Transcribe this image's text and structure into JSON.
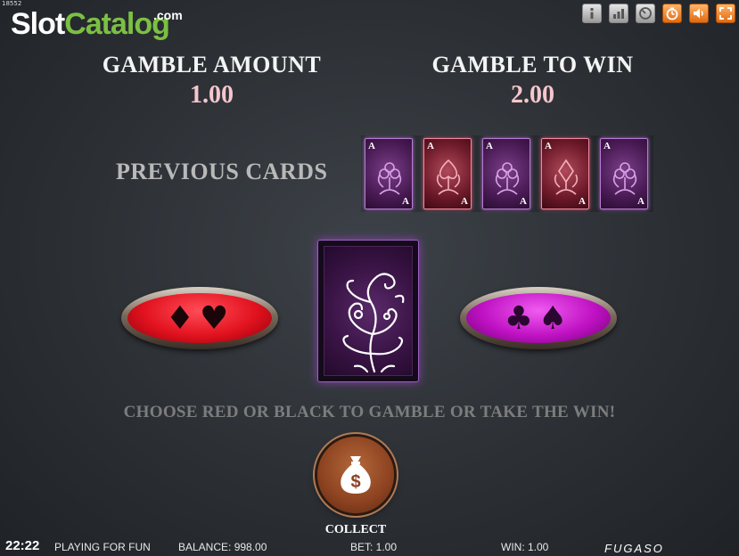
{
  "watermark": {
    "build_id": "18552",
    "logo_slot": "Slot",
    "logo_catalog": "Catalog",
    "logo_com": ".com"
  },
  "toolbar": {
    "buttons": [
      {
        "name": "info-button",
        "icon": "info-icon"
      },
      {
        "name": "paytable-button",
        "icon": "bar-chart-icon"
      },
      {
        "name": "settings-button",
        "icon": "gauge-icon"
      },
      {
        "name": "autoplay-button",
        "icon": "clock-icon"
      },
      {
        "name": "sound-button",
        "icon": "speaker-icon"
      },
      {
        "name": "fullscreen-button",
        "icon": "fullscreen-icon"
      }
    ]
  },
  "gamble": {
    "amount_label": "GAMBLE AMOUNT",
    "amount_value": "1.00",
    "to_win_label": "GAMBLE TO WIN",
    "to_win_value": "2.00",
    "previous_cards_label": "PREVIOUS CARDS",
    "previous_cards": [
      {
        "rank": "A",
        "suit": "clubs",
        "color": "black"
      },
      {
        "rank": "A",
        "suit": "spades",
        "color": "red"
      },
      {
        "rank": "A",
        "suit": "clubs",
        "color": "black"
      },
      {
        "rank": "A",
        "suit": "diamonds",
        "color": "red"
      },
      {
        "rank": "A",
        "suit": "clubs",
        "color": "black"
      }
    ],
    "red_button_suits": "♦♥",
    "black_button_suits": "♣♠",
    "instruction": "CHOOSE RED OR BLACK TO GAMBLE OR TAKE THE WIN!",
    "collect_label": "COLLECT",
    "collect_symbol": "$"
  },
  "status": {
    "clock": "22:22",
    "mode": "PLAYING FOR FUN",
    "balance": "BALANCE: 998.00",
    "bet": "BET: 1.00",
    "win": "WIN: 1.00",
    "provider": "FUGASO"
  },
  "colors": {
    "red_button": "#e2121f",
    "black_button": "#c012c4",
    "value_pink": "#f6c6cd",
    "logo_green": "#7bc043"
  }
}
